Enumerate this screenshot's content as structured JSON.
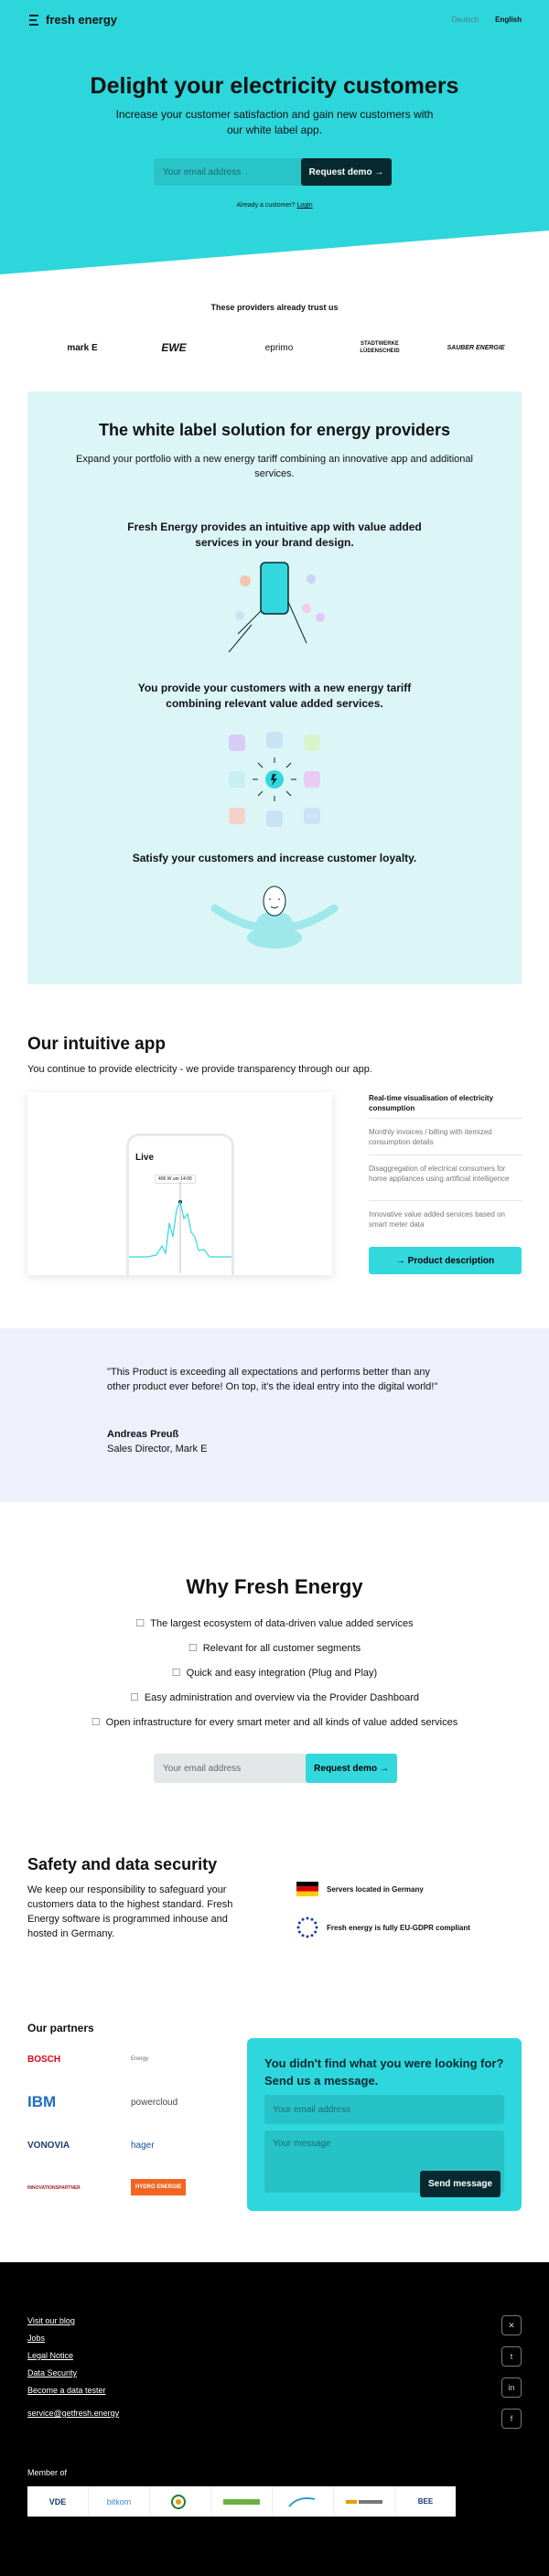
{
  "nav": {
    "brand": "fresh energy",
    "lang_de": "Deutsch",
    "lang_en": "English"
  },
  "hero": {
    "title": "Delight your electricity customers",
    "subtitle": "Increase your customer satisfaction and gain new customers with our white label app.",
    "email_placeholder": "Your email address",
    "cta": "Request demo →",
    "existing_text": "Already a customer?",
    "login": "Login",
    "bg_color": "#2dd6db"
  },
  "providers": {
    "title": "These providers already trust us",
    "logos": [
      "mark E",
      "EWE",
      "eprimo",
      "STADTWERKE LÜDENSCHEID",
      "SAUBER ENERGIE"
    ]
  },
  "white_label": {
    "title": "The white label solution for energy providers",
    "subtitle": "Expand your portfolio with a new energy tariff combining an innovative app and additional services.",
    "points": [
      "Fresh Energy provides an intuitive app with value added services in your brand design.",
      "You provide your customers with a new energy tariff combining relevant value added services.",
      "Satisfy your customers and increase customer loyalty."
    ]
  },
  "app": {
    "title": "Our intuitive app",
    "subtitle": "You continue to provide electricity - we provide transparency through our app.",
    "phone_label": "Live",
    "phone_tooltip": "406 W um 14:00",
    "features": [
      "Real-time visualisation of electricity consumption",
      "Monthly invoices / billing with itemized consumption details",
      "Disaggregation of electrical consumers for home appliances using artificial intelligence",
      "Innovative value added services based on smart meter data"
    ],
    "button": "→ Product description"
  },
  "testimonial": {
    "quote": "\"This Product is exceeding all expectations and performs better than any other product ever before! On top, it's the ideal entry into the digital world!\"",
    "name": "Andreas Preuß",
    "role": "Sales Director, Mark E"
  },
  "why": {
    "title": "Why Fresh Energy",
    "items": [
      "The largest ecosystem of data-driven value added services",
      "Relevant for all customer segments",
      "Quick and easy integration (Plug and Play)",
      "Easy administration and overview via the Provider Dashboard",
      "Open infrastructure for every smart meter and all kinds of value added services"
    ],
    "email_placeholder": "Your email address",
    "cta": "Request demo →"
  },
  "security": {
    "title": "Safety and data security",
    "text": "We keep our responsibility to safeguard your customers data to the highest standard. Fresh Energy software is programmed inhouse and hosted in Germany.",
    "items": [
      "Servers located in Germany",
      "Fresh energy is fully EU-GDPR compliant"
    ]
  },
  "partners": {
    "title": "Our partners",
    "logos": [
      "BOSCH",
      "Energy",
      "IBM",
      "powercloud",
      "VONOVIA",
      "hager",
      "INNOVATIONSPARTNER",
      "HYDRO ENERGIE"
    ]
  },
  "contact": {
    "title": "You didn't find what you were looking for? Send us a message.",
    "email_placeholder": "Your email address",
    "message_placeholder": "Your message",
    "button": "Send message"
  },
  "footer": {
    "links": [
      "Visit our blog",
      "Jobs",
      "Legal Notice",
      "Data Security",
      "Become a data tester"
    ],
    "email": "service@getfresh.energy",
    "member_title": "Member of",
    "members": [
      "VDE",
      "bitkom",
      "",
      "",
      "",
      "",
      "BEE"
    ]
  }
}
